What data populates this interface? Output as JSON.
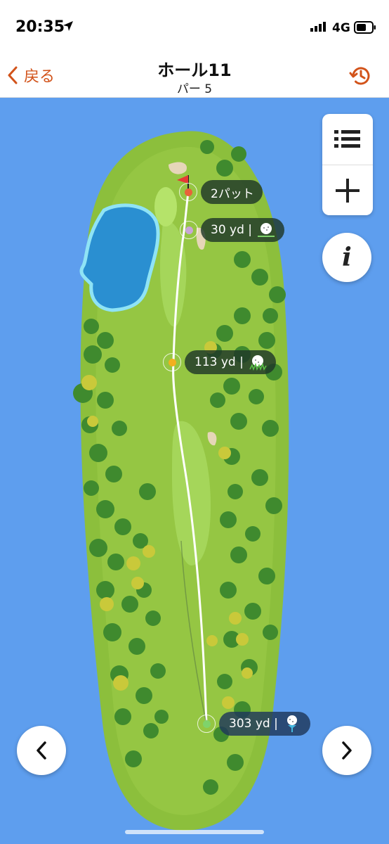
{
  "status": {
    "time": "20:35",
    "network": "4G"
  },
  "nav": {
    "back_label": "戻る",
    "title": "ホール11",
    "subtitle": "パー 5"
  },
  "shots": [
    {
      "label": "2パット",
      "color": "#e8623a",
      "icon": ""
    },
    {
      "label": "30 yd |",
      "color": "#c9a6d6",
      "icon": "ball-icon"
    },
    {
      "label": "113 yd |",
      "color": "#f2b01e",
      "icon": "ball-rough-icon"
    },
    {
      "label": "303 yd |",
      "color": "#7fd36b",
      "icon": "ball-tee-icon"
    }
  ],
  "icons": {
    "list": "list-icon",
    "add": "plus-icon",
    "info": "info-icon",
    "prev": "chevron-left-icon",
    "next": "chevron-right-icon",
    "history": "history-icon",
    "flag": "flag-icon"
  },
  "colors": {
    "accent": "#d2531a",
    "water": "#5e9eee"
  }
}
